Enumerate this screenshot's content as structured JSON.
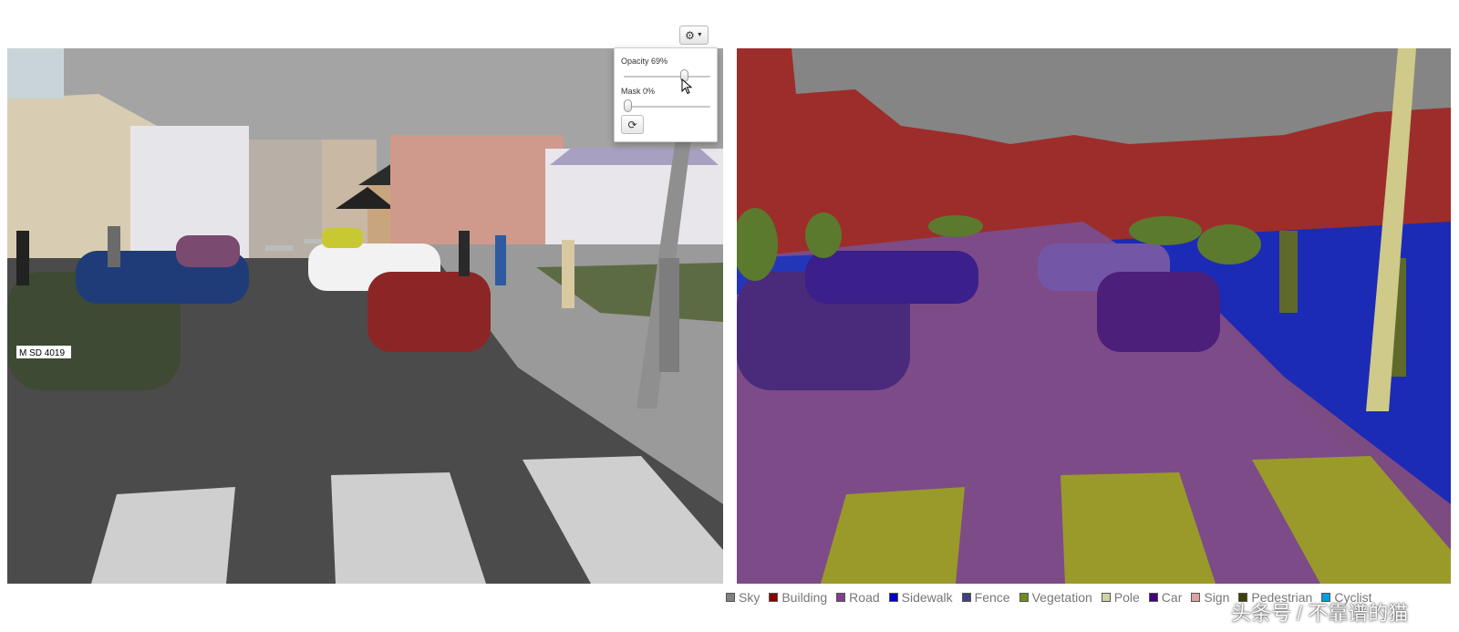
{
  "settings": {
    "icon": "gear-icon",
    "opacity_label": "Opacity 69%",
    "opacity_value": 69,
    "mask_label": "Mask 0%",
    "mask_value": 0,
    "refresh_icon": "refresh-icon"
  },
  "plate_text": "M SD 4019",
  "legend": [
    {
      "label": "Sky",
      "color": "#808080"
    },
    {
      "label": "Building",
      "color": "#8b0000"
    },
    {
      "label": "Road",
      "color": "#80408a"
    },
    {
      "label": "Sidewalk",
      "color": "#0000c8"
    },
    {
      "label": "Fence",
      "color": "#404080"
    },
    {
      "label": "Vegetation",
      "color": "#6b8e23"
    },
    {
      "label": "Pole",
      "color": "#d2d2a0"
    },
    {
      "label": "Car",
      "color": "#400080"
    },
    {
      "label": "Sign",
      "color": "#e0a0a0"
    },
    {
      "label": "Pedestrian",
      "color": "#404000"
    },
    {
      "label": "Cyclist",
      "color": "#00a0e0"
    }
  ],
  "watermark": "头条号 / 不靠谱的猫"
}
